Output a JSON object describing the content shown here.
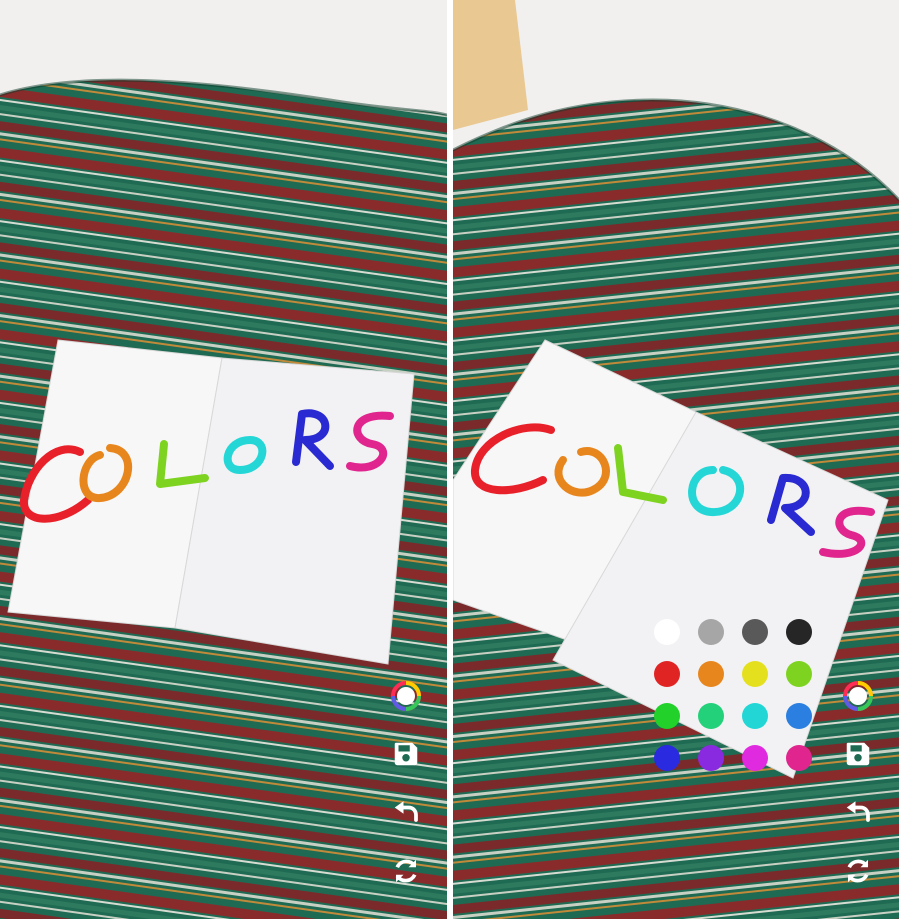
{
  "screens": [
    {
      "name": "drawing-view",
      "ar_text": "COLORS",
      "letter_colors": [
        "#e8202a",
        "#e8861e",
        "#7ed321",
        "#25d6d6",
        "#2a2ad2",
        "#e0268e"
      ],
      "toolbar": [
        "color-picker-icon",
        "save-icon",
        "undo-icon",
        "refresh-icon"
      ],
      "palette_open": false
    },
    {
      "name": "palette-view",
      "ar_text": "COLORS",
      "letter_colors": [
        "#e8202a",
        "#e8861e",
        "#7ed321",
        "#25d6d6",
        "#2a2ad2",
        "#e0268e"
      ],
      "toolbar": [
        "color-picker-icon",
        "save-icon",
        "undo-icon",
        "refresh-icon"
      ],
      "palette_open": true
    }
  ],
  "palette": {
    "colors": [
      "#ffffff",
      "#a6a6a6",
      "#595959",
      "#262626",
      "#e02424",
      "#e8861e",
      "#e4e01e",
      "#7ed321",
      "#22d12a",
      "#22d17a",
      "#22d6d6",
      "#2a7fe0",
      "#2a2ae0",
      "#8a2ae0",
      "#e02ae0",
      "#e0268e"
    ]
  }
}
